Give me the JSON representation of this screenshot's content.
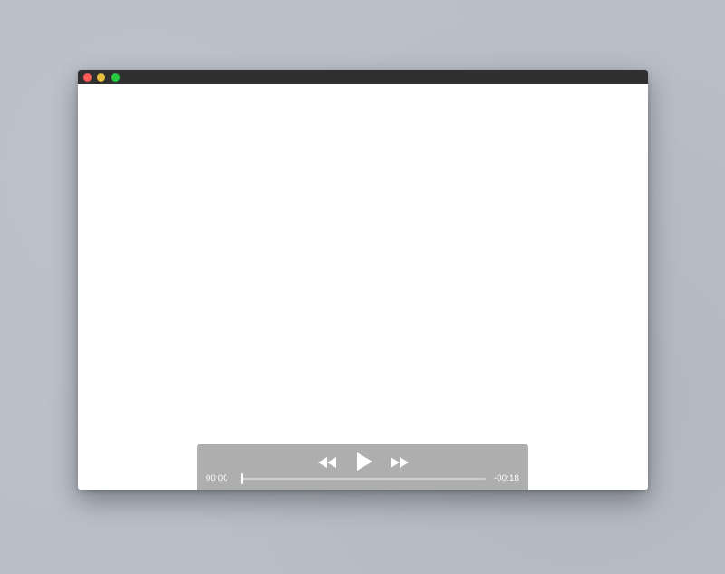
{
  "window": {
    "traffic_lights": {
      "close_color": "#fc5b57",
      "minimize_color": "#e5bf3c",
      "zoom_color": "#27c93f"
    }
  },
  "player": {
    "buttons": {
      "rewind_icon": "rewind-icon",
      "play_icon": "play-icon",
      "fast_forward_icon": "fast-forward-icon"
    },
    "elapsed_time": "00:00",
    "remaining_time": "-00:18",
    "progress": 0.0
  }
}
